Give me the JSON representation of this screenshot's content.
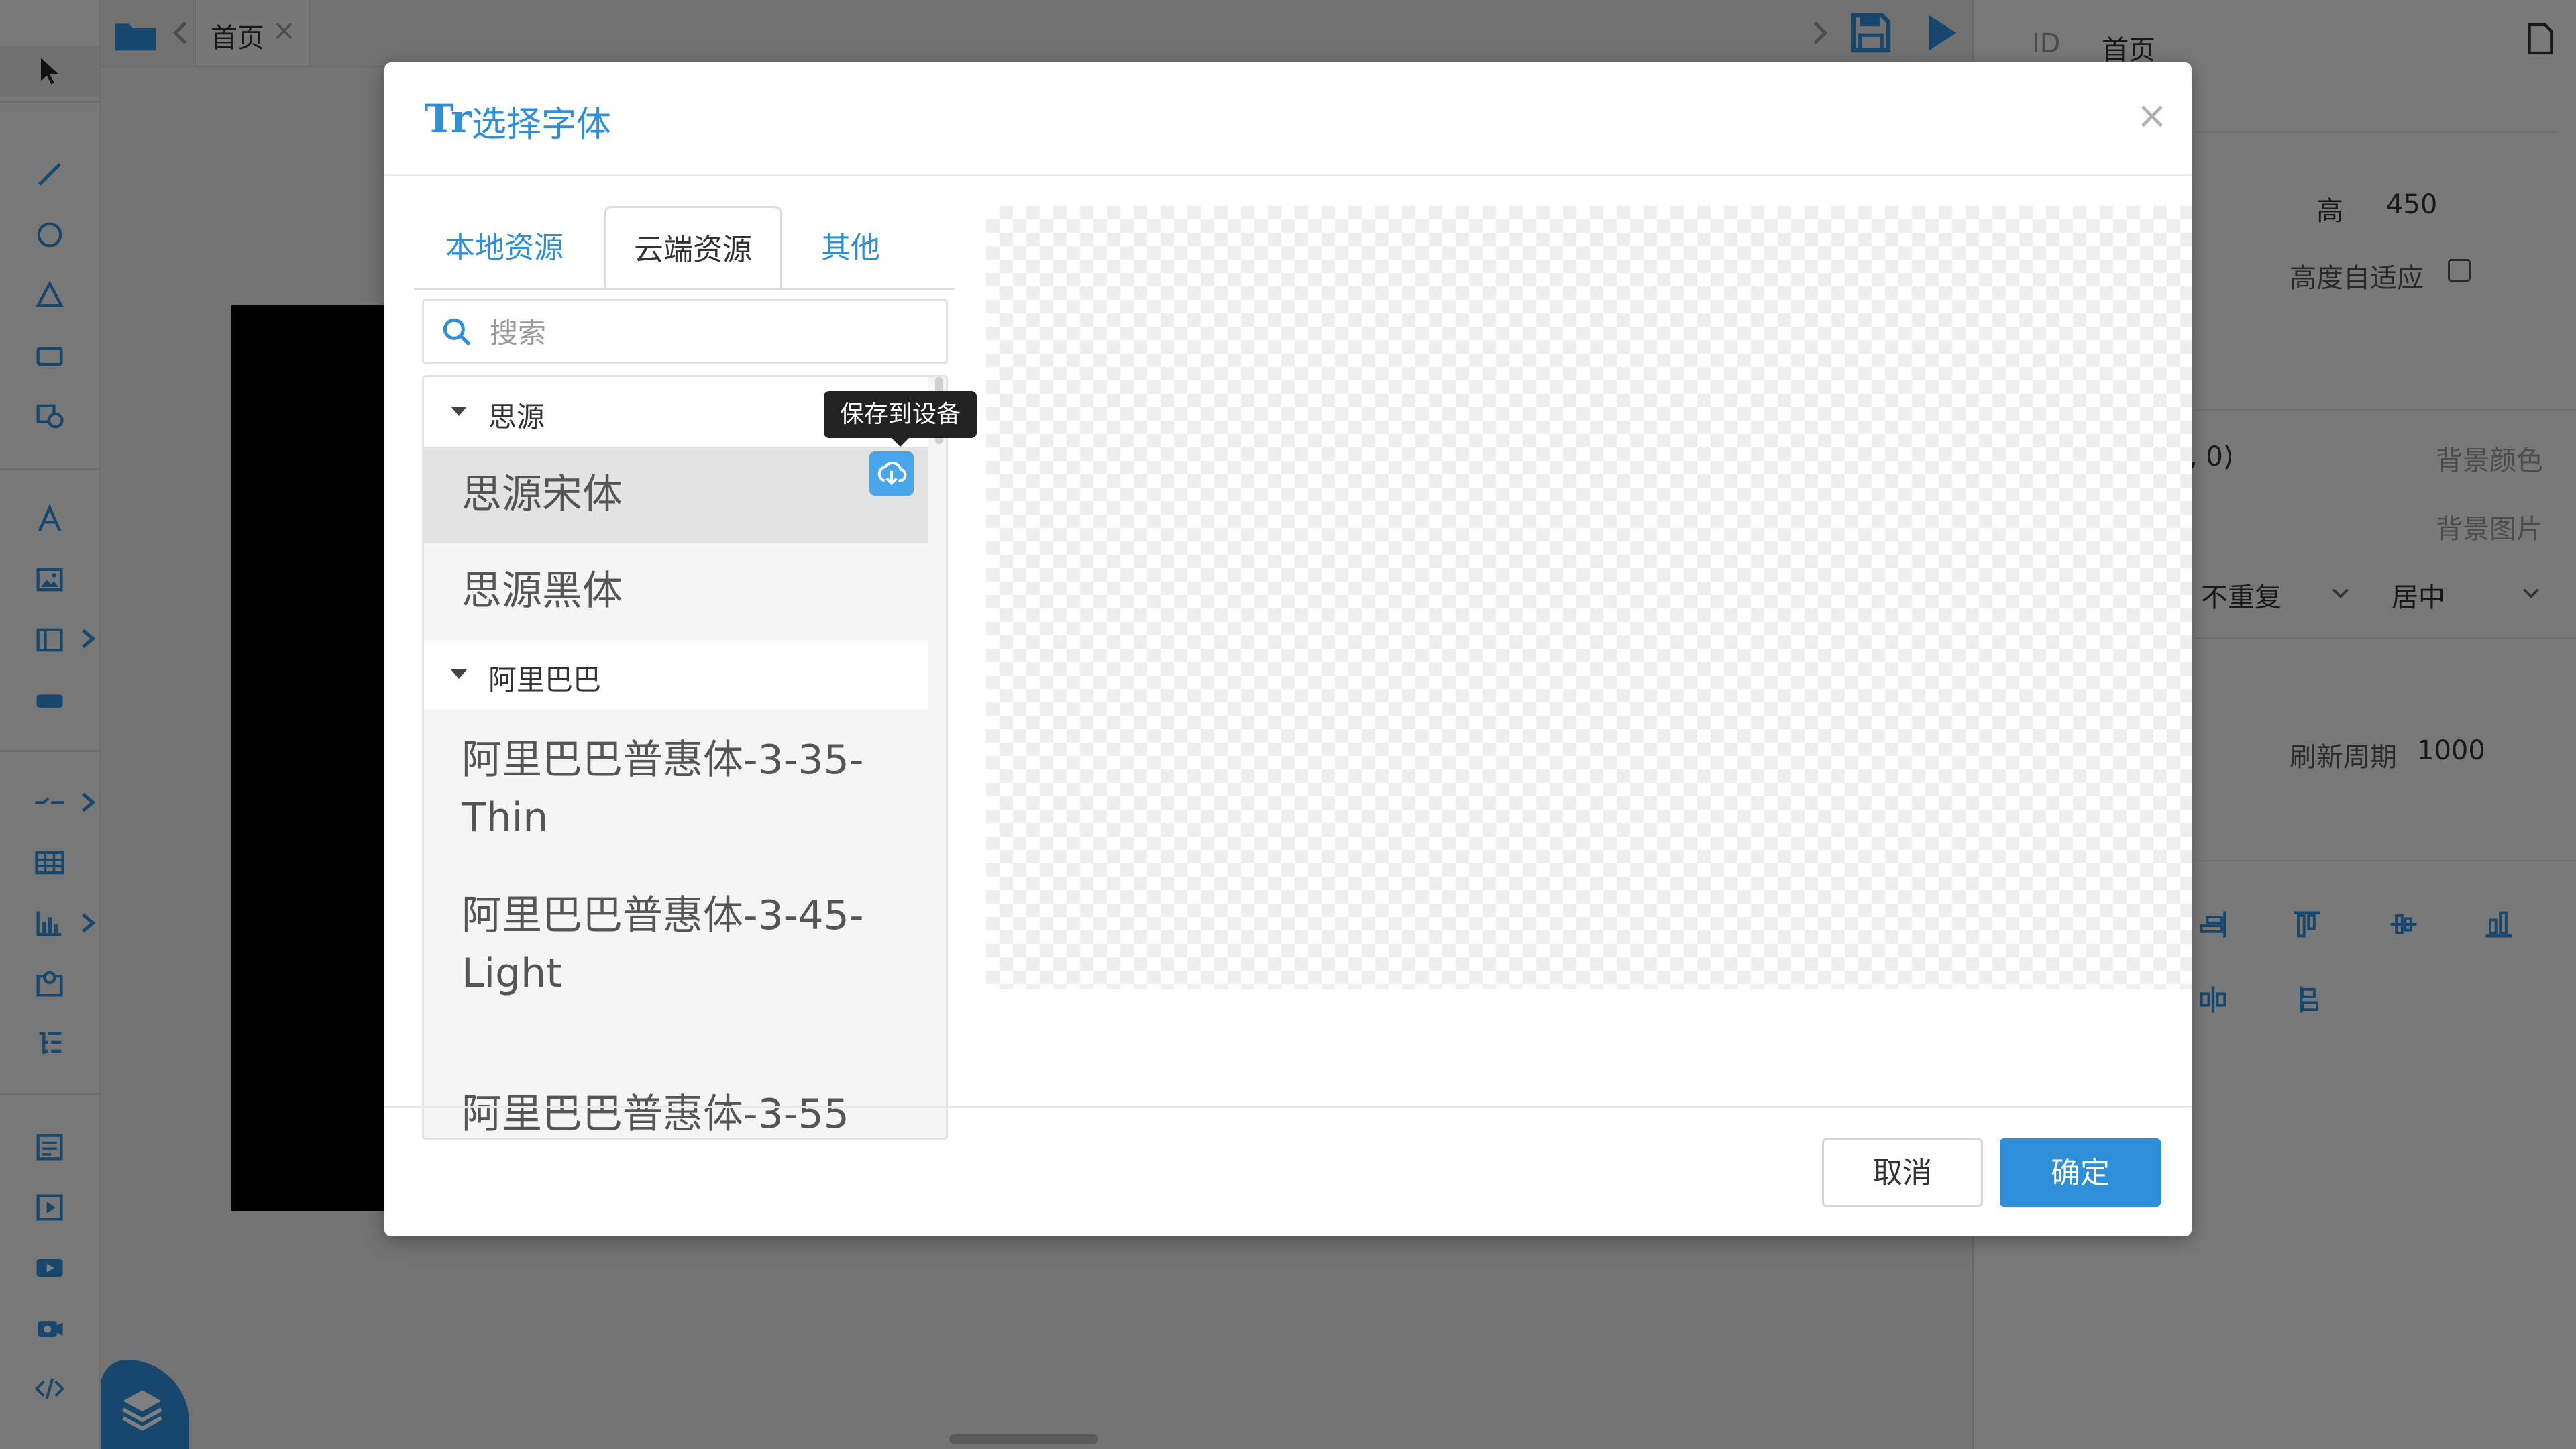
{
  "tabbar": {
    "tab_label": "首页"
  },
  "right_panel": {
    "id_label": "ID",
    "id_value": "首页",
    "height_label": "高",
    "height_value": "450",
    "auto_height_label": "高度自适应",
    "bg_color_value_partial": ", 0)",
    "bg_color_label": "背景颜色",
    "bg_image_label": "背景图片",
    "repeat_select": "不重复",
    "position_select": "居中",
    "refresh_label": "刷新周期",
    "refresh_value": "1000"
  },
  "dialog": {
    "title_icon": "Tr",
    "title": "选择字体",
    "close_glyph": "×",
    "tabs": [
      "本地资源",
      "云端资源",
      "其他"
    ],
    "active_tab": "云端资源",
    "search_placeholder": "搜索",
    "groups": [
      {
        "name": "思源",
        "fonts": [
          "思源宋体",
          "思源黑体"
        ]
      },
      {
        "name": "阿里巴巴",
        "fonts": [
          "阿里巴巴普惠体-3-35-Thin",
          "阿里巴巴普惠体-3-45-Light",
          "阿里巴巴普惠体-3-55"
        ]
      }
    ],
    "font_lines": {
      "thin_a": "阿里巴巴普惠体-3-35-",
      "thin_b": "Thin",
      "light_a": "阿里巴巴普惠体-3-45-",
      "light_b": "Light",
      "regular_a": "阿里巴巴普惠体-3-55"
    },
    "tooltip": "保存到设备",
    "cancel_label": "取消",
    "confirm_label": "确定"
  },
  "icons": {
    "select": "pointer-arrow-icon",
    "cloud": "cloud-download-icon",
    "search": "search-icon"
  },
  "colors": {
    "accent": "#2e8fd8",
    "tooltip_bg": "#222222",
    "overlay": "rgba(0,0,0,0.5)"
  }
}
